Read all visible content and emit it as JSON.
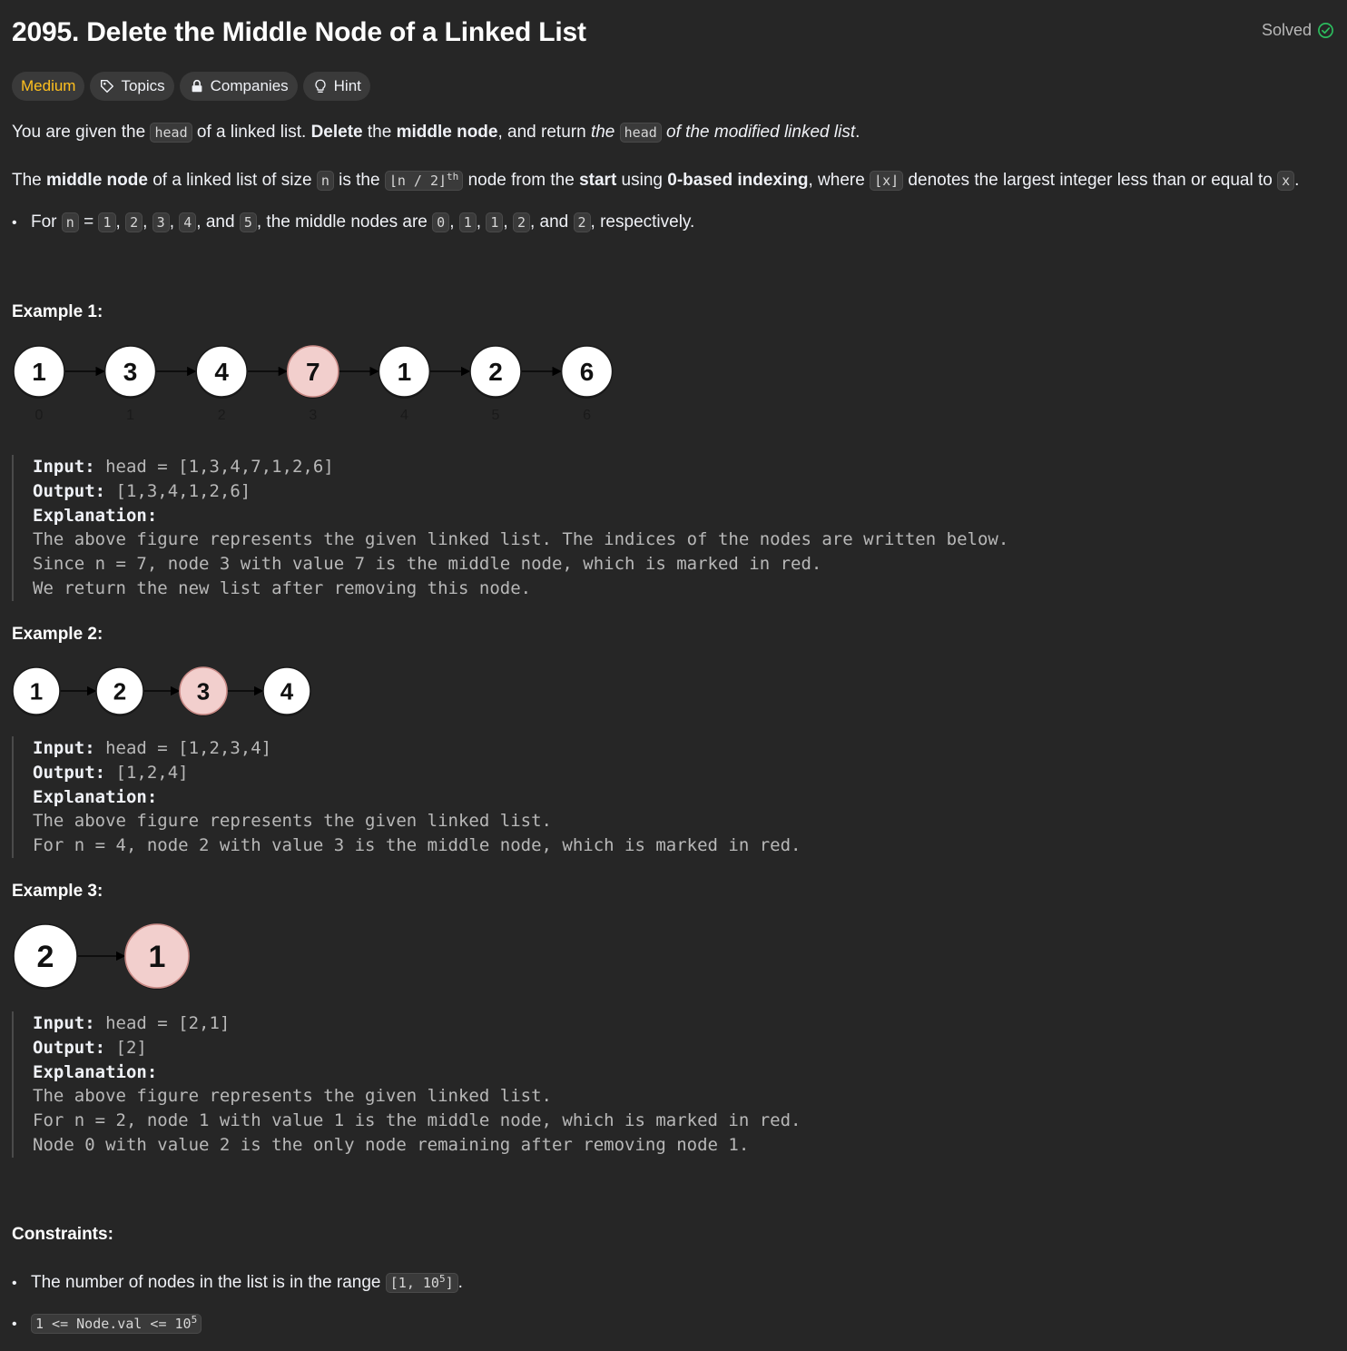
{
  "problem": {
    "title": "2095. Delete the Middle Node of a Linked List",
    "status": "Solved"
  },
  "tags": {
    "difficulty": "Medium",
    "topics": "Topics",
    "companies": "Companies",
    "hint": "Hint"
  },
  "description": {
    "p1": {
      "t1": "You are given the ",
      "c1": "head",
      "t2": " of a linked list. ",
      "b1": "Delete",
      "t3": " the ",
      "b2": "middle node",
      "t4": ", and return ",
      "i1": "the",
      "c2": "head",
      "i2": "of the modified linked list",
      "t5": "."
    },
    "p2": {
      "t1": "The ",
      "b1": "middle node",
      "t2": " of a linked list of size ",
      "c1": "n",
      "t3": " is the ",
      "c2": "⌊n / 2⌋",
      "sup": "th",
      "t4": " node from the ",
      "b2": "start",
      "t5": " using ",
      "b3": "0-based indexing",
      "t6": ", where ",
      "c3": "⌊x⌋",
      "t7": " denotes the largest integer less than or equal to ",
      "c4": "x",
      "t8": "."
    },
    "bullet": {
      "t1": "For ",
      "c_n": "n",
      "t2": " = ",
      "n_vals": [
        "1",
        "2",
        "3",
        "4",
        "5"
      ],
      "t3": ", the middle nodes are ",
      "m_vals": [
        "0",
        "1",
        "1",
        "2",
        "2"
      ],
      "and": "and",
      "t4": ", respectively."
    }
  },
  "examples": [
    {
      "heading": "Example 1:",
      "nodes": [
        "1",
        "3",
        "4",
        "7",
        "1",
        "2",
        "6"
      ],
      "indices": [
        "0",
        "1",
        "2",
        "3",
        "4",
        "5",
        "6"
      ],
      "middle_index": 3,
      "input_label": "Input:",
      "input_value": " head = [1,3,4,7,1,2,6]",
      "output_label": "Output:",
      "output_value": " [1,3,4,1,2,6]",
      "explanation_label": "Explanation:",
      "explanation_lines": [
        "The above figure represents the given linked list. The indices of the nodes are written below.",
        "Since n = 7, node 3 with value 7 is the middle node, which is marked in red.",
        "We return the new list after removing this node."
      ]
    },
    {
      "heading": "Example 2:",
      "nodes": [
        "1",
        "2",
        "3",
        "4"
      ],
      "middle_index": 2,
      "input_label": "Input:",
      "input_value": " head = [1,2,3,4]",
      "output_label": "Output:",
      "output_value": " [1,2,4]",
      "explanation_label": "Explanation:",
      "explanation_lines": [
        "The above figure represents the given linked list.",
        "For n = 4, node 2 with value 3 is the middle node, which is marked in red."
      ]
    },
    {
      "heading": "Example 3:",
      "nodes": [
        "2",
        "1"
      ],
      "middle_index": 1,
      "input_label": "Input:",
      "input_value": " head = [2,1]",
      "output_label": "Output:",
      "output_value": " [2]",
      "explanation_label": "Explanation:",
      "explanation_lines": [
        "The above figure represents the given linked list.",
        "For n = 2, node 1 with value 1 is the middle node, which is marked in red.",
        "Node 0 with value 2 is the only node remaining after removing node 1."
      ]
    }
  ],
  "constraints": {
    "heading": "Constraints:",
    "c1_text": "The number of nodes in the list is in the range ",
    "c1_code": "[1, 10",
    "c1_sup": "5",
    "c1_code_end": "]",
    "c1_end": ".",
    "c2_code": "1 <= Node.val <= 10",
    "c2_sup": "5"
  },
  "colors": {
    "background": "#262626",
    "medium": "#ffc01e",
    "solved_check": "#2cbb5d",
    "node_middle_fill": "#f2cfcd",
    "node_fill": "#ffffff"
  }
}
